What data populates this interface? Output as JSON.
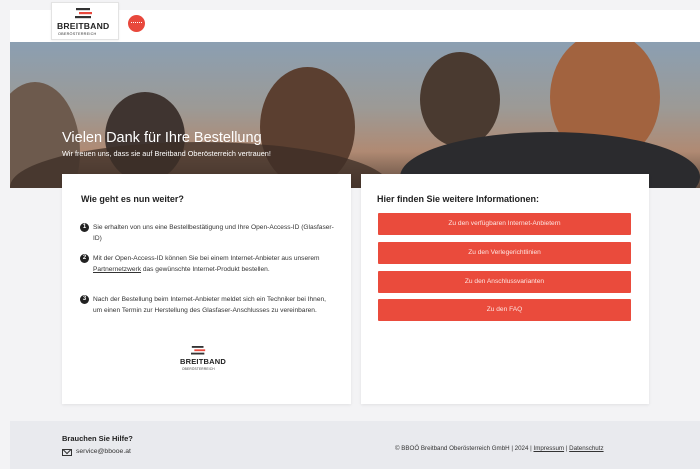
{
  "brand": {
    "logo_text": "BREITBAND",
    "logo_subtext": "OBERÖSTERREICH",
    "accent_color": "#ea4b3c"
  },
  "hero": {
    "title": "Vielen Dank für Ihre Bestellung",
    "subtitle": "Wir freuen uns, dass sie auf Breitband Oberösterreich vertrauen!"
  },
  "steps_card": {
    "title": "Wie geht es nun weiter?",
    "steps": [
      {
        "number": "1",
        "text": "Sie erhalten von uns eine Bestellbestätigung und Ihre Open-Access-ID (Glasfaser-ID)"
      },
      {
        "number": "2",
        "text_before": "Mit der Open-Access-ID können Sie bei einem Internet-Anbieter aus unserem ",
        "link": "Partnernetzwerk",
        "text_after": " das gewünschte Internet-Produkt bestellen."
      },
      {
        "number": "3",
        "text": "Nach der Bestellung beim Internet-Anbieter meldet sich ein Techniker bei Ihnen, um einen Termin zur Herstellung des Glasfaser-Anschlusses zu vereinbaren."
      }
    ]
  },
  "info_card": {
    "title": "Hier finden Sie weitere Informationen:",
    "buttons": [
      "Zu den verfügbaren Internet-Anbietern",
      "Zu den Verlegerichtlinien",
      "Zu den Anschlussvarianten",
      "Zu den FAQ"
    ]
  },
  "footer": {
    "help_title": "Brauchen Sie Hilfe?",
    "email": "service@bbooe.at",
    "copyright": "© BBOÖ Breitband Oberösterreich GmbH | 2024 |",
    "impressum": "Impressum",
    "separator": "|",
    "datenschutz": "Datenschutz",
    "mail_icon": "mail-icon"
  }
}
